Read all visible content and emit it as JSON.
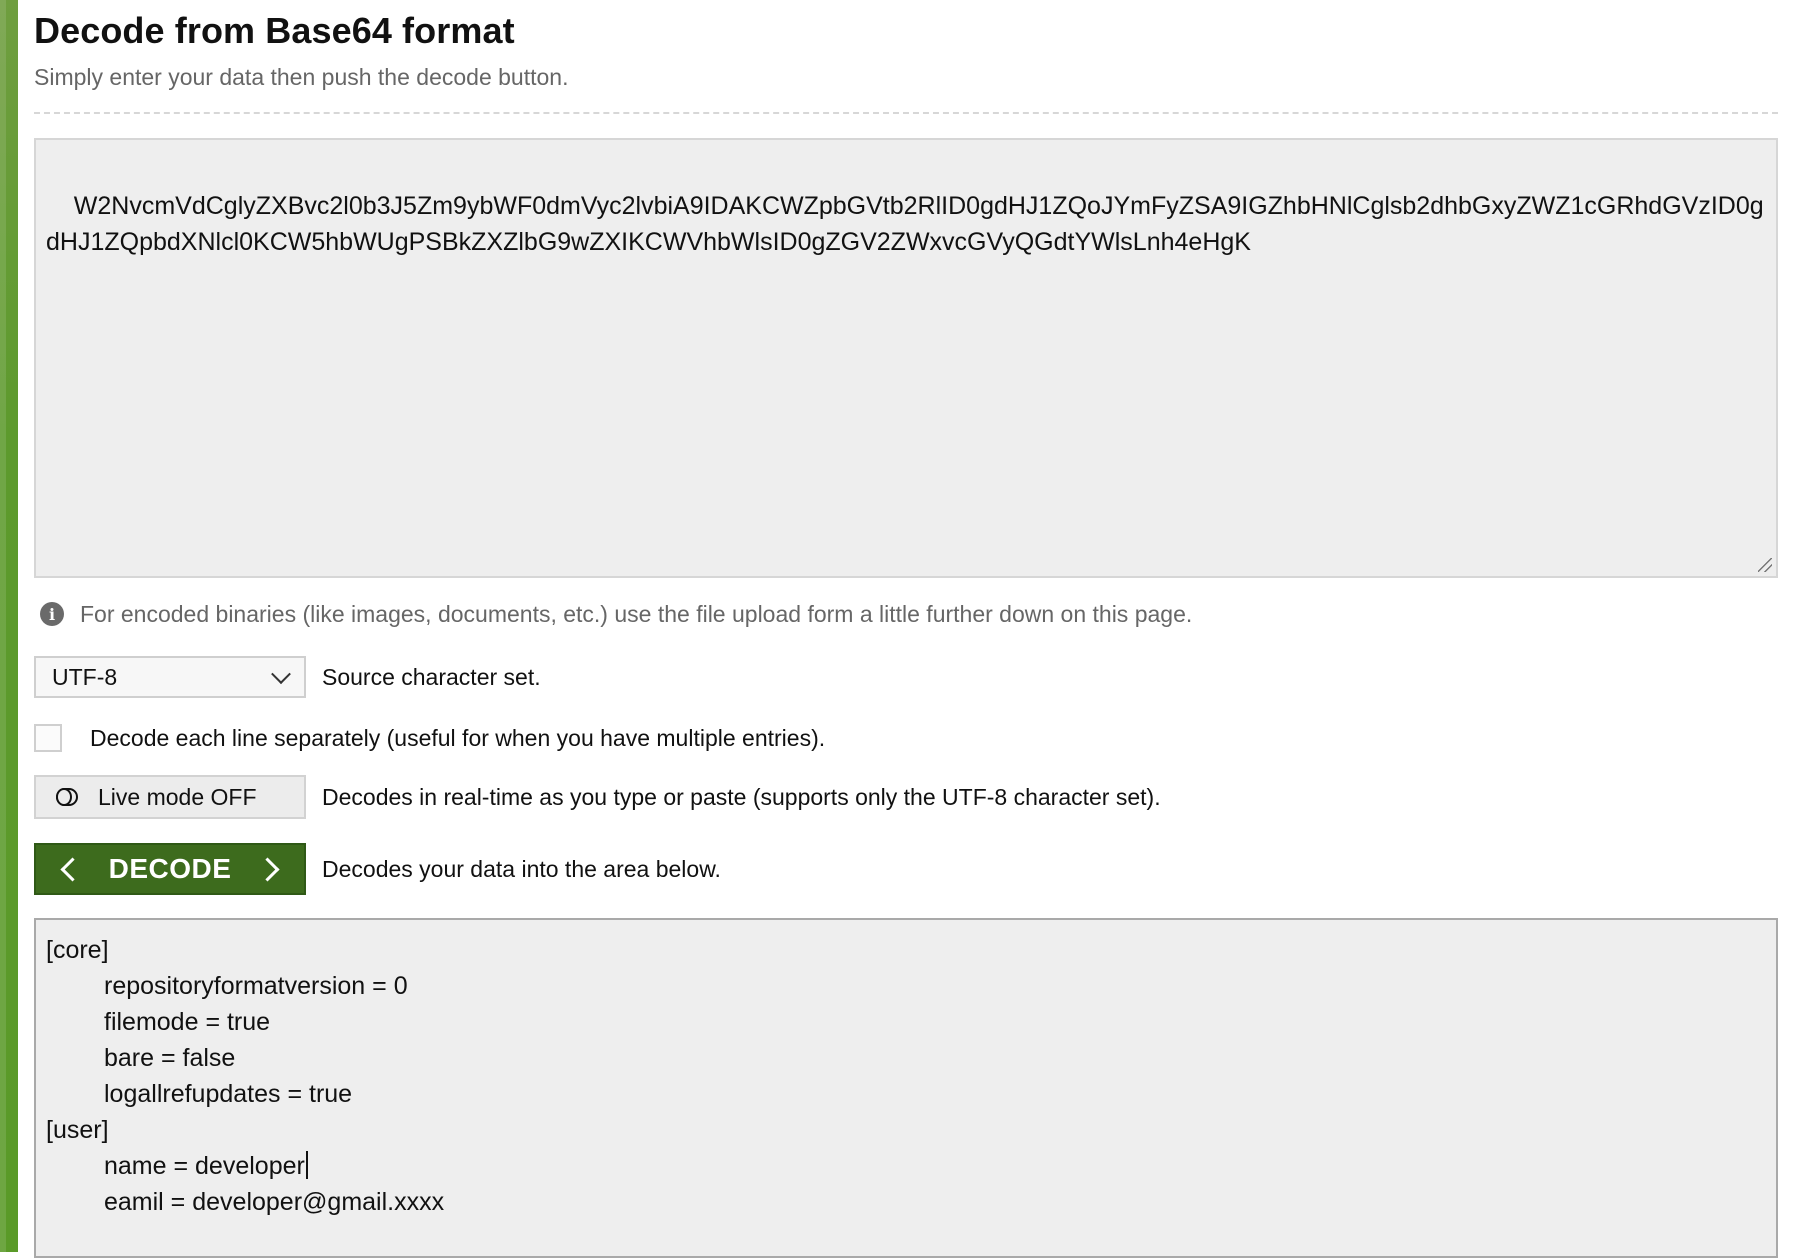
{
  "page": {
    "title": "Decode from Base64 format",
    "subtitle": "Simply enter your data then push the decode button."
  },
  "input": {
    "value": "W2NvcmVdCglyZXBvc2l0b3J5Zm9ybWF0dmVyc2lvbiA9IDAKCWZpbGVtb2RlID0gdHJ1ZQoJYmFyZSA9IGZhbHNlCglsb2dhbGxyZWZ1cGRhdGVzID0gdHJ1ZQpbdXNlcl0KCW5hbWUgPSBkZXZlbG9wZXIKCWVhbWlsID0gZGV2ZWxvcGVyQGdtYWlsLnh4eHgK"
  },
  "hint": {
    "text": "For encoded binaries (like images, documents, etc.) use the file upload form a little further down on this page.",
    "icon": "info-icon"
  },
  "charset": {
    "selected": "UTF-8",
    "label": "Source character set."
  },
  "line_separately": {
    "checked": false,
    "label": "Decode each line separately (useful for when you have multiple entries)."
  },
  "live_mode": {
    "button_label": "Live mode OFF",
    "description": "Decodes in real-time as you type or paste (supports only the UTF-8 character set).",
    "icon": "toggle-off-icon"
  },
  "decode": {
    "button_label": "DECODE",
    "description": "Decodes your data into the area below.",
    "icons": [
      "chevron-left-icon",
      "chevron-right-icon"
    ]
  },
  "output": {
    "lines": [
      {
        "text": "[core]",
        "indent": false
      },
      {
        "text": "repositoryformatversion = 0",
        "indent": true
      },
      {
        "text": "filemode = true",
        "indent": true
      },
      {
        "text": "bare = false",
        "indent": true
      },
      {
        "text": "logallrefupdates = true",
        "indent": true
      },
      {
        "text": "[user]",
        "indent": false
      },
      {
        "text": "name = developer",
        "indent": true,
        "caret": true
      },
      {
        "text": "eamil = developer@gmail.xxxx",
        "indent": true
      }
    ]
  },
  "colors": {
    "accent_green": "#3d6b1d",
    "rail_green": "#5d9a2d",
    "field_bg": "#eeeeee"
  }
}
